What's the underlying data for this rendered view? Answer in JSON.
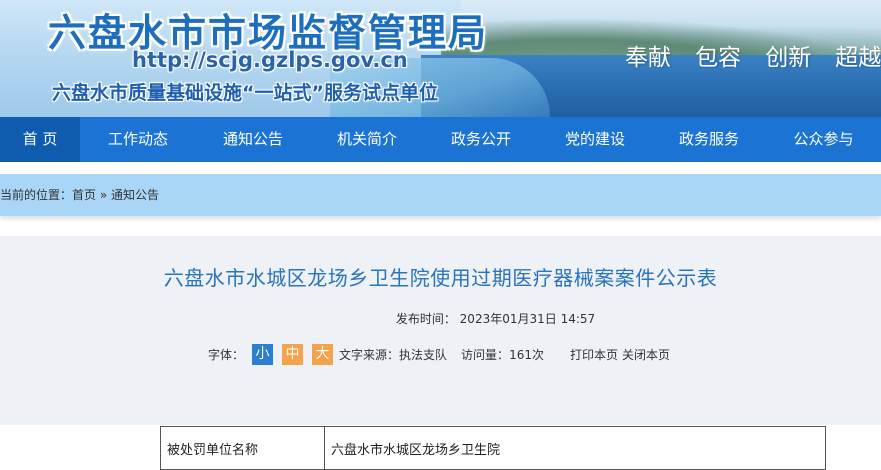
{
  "banner": {
    "title": "六盘水市市场监督管理局",
    "url": "http://scjg.gzlps.gov.cn",
    "subtitle": "六盘水市质量基础设施“一站式”服务试点单位",
    "slogans": [
      "奉献",
      "包容",
      "创新",
      "超越"
    ]
  },
  "nav": {
    "items": [
      {
        "label": "首 页"
      },
      {
        "label": "工作动态"
      },
      {
        "label": "通知公告"
      },
      {
        "label": "机关简介"
      },
      {
        "label": "政务公开"
      },
      {
        "label": "党的建设"
      },
      {
        "label": "政务服务"
      },
      {
        "label": "公众参与"
      }
    ]
  },
  "breadcrumb": {
    "prefix": "您当前的位置：",
    "home": "首页",
    "separator": "»",
    "current": "通知公告"
  },
  "article": {
    "title": "六盘水市水城区龙场乡卫生院使用过期医疗器械案案件公示表",
    "pubdate_label": "发布时间：",
    "pubdate": "2023年01月31日 14:57",
    "font_label": "字体：",
    "font_small": "小",
    "font_mid": "中",
    "font_large": "大",
    "source_label": "文字来源：",
    "source": "执法支队",
    "views_label": "访问量：",
    "views": "161次",
    "print": "打印本页",
    "close": "关闭本页"
  },
  "table": {
    "rows": [
      {
        "key": "被处罚单位名称",
        "value": "六盘水市水城区龙场乡卫生院"
      }
    ]
  },
  "colors": {
    "nav_bg": "#1b74d4",
    "nav_active": "#0f5cae",
    "breadcrumb_bg": "#a9d5f6",
    "title_blue": "#2a73bd",
    "font_btn_blue": "#2a7fd0",
    "font_btn_orange": "#f4a24b"
  }
}
